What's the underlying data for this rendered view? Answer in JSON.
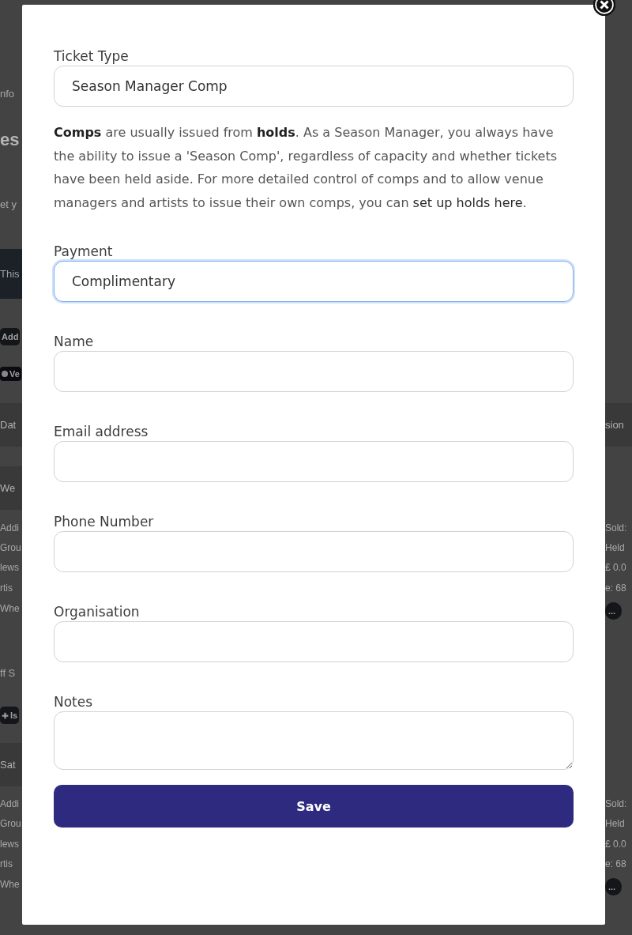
{
  "background": {
    "left": [
      {
        "kind": "label",
        "text": "nfo"
      },
      {
        "kind": "heading",
        "text": "es"
      },
      {
        "kind": "label",
        "text": "et y"
      },
      {
        "kind": "dark",
        "text": "This"
      },
      {
        "kind": "button",
        "text": "Add"
      },
      {
        "kind": "pill",
        "text": "Ve"
      },
      {
        "kind": "band",
        "text": "Dat"
      },
      {
        "kind": "band",
        "text": "We"
      },
      {
        "kind": "small",
        "text": "Addi"
      },
      {
        "kind": "small",
        "text": "Grou"
      },
      {
        "kind": "small",
        "text": "lews"
      },
      {
        "kind": "small",
        "text": "rtis"
      },
      {
        "kind": "small",
        "text": "Whe"
      },
      {
        "kind": "label",
        "text": "ff S"
      },
      {
        "kind": "plus",
        "text": "Is"
      },
      {
        "kind": "band",
        "text": "Sat"
      },
      {
        "kind": "small",
        "text": "Addi"
      },
      {
        "kind": "small",
        "text": "Grou"
      },
      {
        "kind": "small",
        "text": "lews"
      },
      {
        "kind": "small",
        "text": "rtis"
      },
      {
        "kind": "small",
        "text": "Whe"
      }
    ],
    "right": [
      {
        "kind": "band",
        "text": "sion"
      },
      {
        "kind": "small",
        "text": "Sold:"
      },
      {
        "kind": "small",
        "text": "Held"
      },
      {
        "kind": "small",
        "text": "£ 0.0"
      },
      {
        "kind": "small",
        "text": "e: 68"
      },
      {
        "kind": "more",
        "text": "..."
      },
      {
        "kind": "small",
        "text": "Sold:"
      },
      {
        "kind": "small",
        "text": "Held"
      },
      {
        "kind": "small",
        "text": "£ 0.0"
      },
      {
        "kind": "small",
        "text": "e: 68"
      },
      {
        "kind": "more",
        "text": "..."
      }
    ]
  },
  "modal": {
    "fields_top": [
      {
        "label": "Ticket Type",
        "kind": "input",
        "value": "Season Manager Comp",
        "focused": false
      }
    ],
    "note": {
      "text": "**Comps** are usually issued from **holds**. As a Season Manager, you always have the ability to issue a 'Season Comp', regardless of capacity and whether tickets have been held aside. For more detailed control of comps and to allow venue managers and artists to issue their own comps, you can ",
      "link": "set up holds here",
      "after": "."
    },
    "fields": [
      {
        "label": "Payment",
        "kind": "input",
        "value": "Complimentary",
        "focused": true
      },
      {
        "label": "Name",
        "kind": "input",
        "focused": false
      },
      {
        "label": "Email address",
        "kind": "input",
        "focused": false
      },
      {
        "label": "Phone Number",
        "kind": "input",
        "focused": false
      },
      {
        "label": "Organisation",
        "kind": "input",
        "focused": false
      },
      {
        "label": "Notes",
        "kind": "textarea",
        "focused": false
      }
    ],
    "save_button": "Save"
  }
}
